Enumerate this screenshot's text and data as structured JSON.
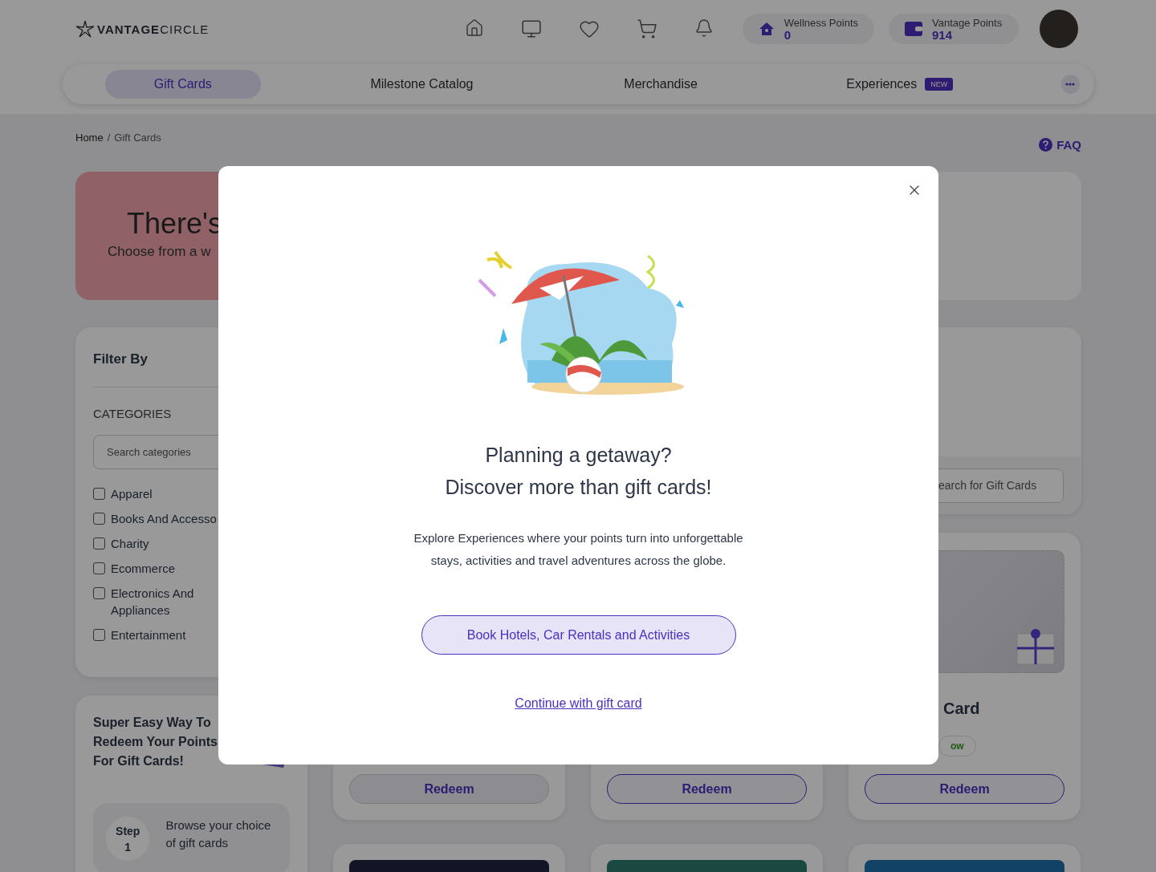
{
  "header": {
    "logo": {
      "bold": "VANTAGE",
      "light": "CIRCLE"
    },
    "points": [
      {
        "kind": "wellness",
        "label": "Wellness Points",
        "value": "0"
      },
      {
        "kind": "vantage",
        "label": "Vantage Points",
        "value": "914"
      }
    ]
  },
  "nav": {
    "tabs": [
      {
        "label": "Gift Cards",
        "selected": true
      },
      {
        "label": "Milestone Catalog",
        "selected": false
      },
      {
        "label": "Merchandise",
        "selected": false
      },
      {
        "label": "Experiences",
        "selected": false,
        "badge": "NEW"
      }
    ]
  },
  "breadcrumb": {
    "items": [
      "Home",
      "Gift Cards"
    ],
    "separator": "/"
  },
  "faq": "FAQ",
  "banner": {
    "title": "There's",
    "subtitle": "Choose from a w"
  },
  "filter": {
    "title": "Filter By",
    "section": "CATEGORIES",
    "placeholder": "Search categories",
    "categories": [
      {
        "label": "Apparel",
        "checked": false
      },
      {
        "label": "Books And Accesso",
        "checked": false
      },
      {
        "label": "Charity",
        "checked": false
      },
      {
        "label": "Ecommerce",
        "checked": false
      },
      {
        "label": "Electronics And Appliances",
        "checked": false
      },
      {
        "label": "Entertainment",
        "checked": false
      }
    ]
  },
  "steps": {
    "title": "Super Easy Way To Redeem Your Points For Gift Cards!",
    "items": [
      {
        "label": "Step",
        "number": "1",
        "text": "Browse your choice of gift cards"
      }
    ]
  },
  "search": {
    "placeholder": "earch for Gift Cards"
  },
  "products": [
    {
      "button": "Redeem",
      "disabled": true
    },
    {
      "button": "Redeem",
      "disabled": false
    },
    {
      "title": "Card",
      "badge": "ow",
      "button": "Redeem",
      "disabled": false
    }
  ],
  "modal": {
    "title_lines": [
      "Planning a getaway?",
      "Discover more than gift cards!"
    ],
    "text": "Explore Experiences where your points turn into unforgettable stays, activities and travel adventures across the globe.",
    "primary_button": "Book Hotels, Car Rentals and Activities",
    "link": "Continue with gift card"
  }
}
